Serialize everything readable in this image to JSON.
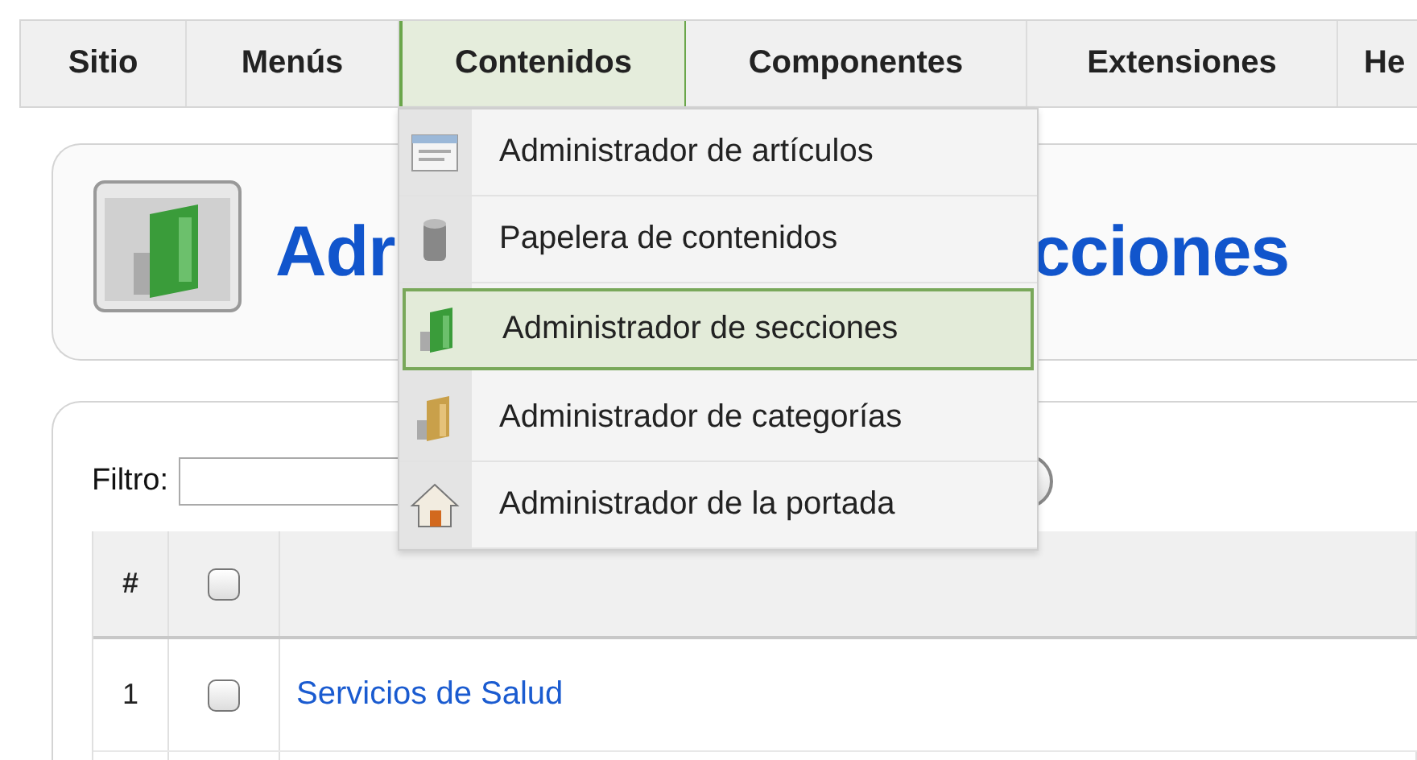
{
  "menu_bar": {
    "tabs": [
      {
        "label": "Sitio",
        "selected": false
      },
      {
        "label": "Menús",
        "selected": false
      },
      {
        "label": "Contenidos",
        "selected": true
      },
      {
        "label": "Componentes",
        "selected": false
      },
      {
        "label": "Extensiones",
        "selected": false
      },
      {
        "label": "He",
        "selected": false
      }
    ]
  },
  "dropdown": {
    "items": [
      {
        "label": "Administrador de artículos",
        "kind": "article",
        "selected": false
      },
      {
        "label": "Papelera de contenidos",
        "kind": "trash",
        "selected": false
      },
      {
        "label": "Administrador de secciones",
        "kind": "section",
        "selected": true
      },
      {
        "label": "Administrador de categorías",
        "kind": "category",
        "selected": false
      },
      {
        "label": "Administrador de la portada",
        "kind": "home",
        "selected": false
      }
    ]
  },
  "header": {
    "title_parts": [
      "Adr",
      "cciones"
    ]
  },
  "filter": {
    "label": "Filtro:"
  },
  "table": {
    "columns": [
      {
        "kind": "number",
        "label": "#"
      },
      {
        "kind": "checkbox",
        "checked": false
      }
    ],
    "rows": [
      {
        "number": "1",
        "checked": false,
        "title": "Servicios de Salud"
      }
    ]
  }
}
